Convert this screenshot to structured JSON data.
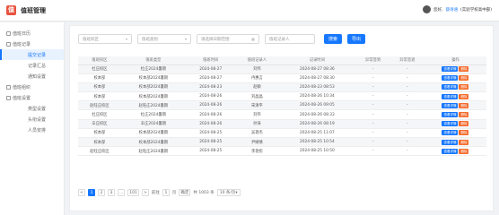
{
  "app": {
    "logo_char": "值",
    "title": "值班管理"
  },
  "user": {
    "greeting": "您好,",
    "name": "薛诗涵",
    "org": "(实验学校高中部)"
  },
  "sidebar": {
    "items": [
      {
        "label": "值班日历",
        "sub": false,
        "icon": "calendar-icon"
      },
      {
        "label": "值班记录",
        "sub": false,
        "icon": "list-icon"
      },
      {
        "label": "提交记录",
        "sub": true,
        "active": true
      },
      {
        "label": "记录汇总",
        "sub": true
      },
      {
        "label": "通知设置",
        "sub": true
      },
      {
        "label": "值班组织",
        "sub": false,
        "icon": "group-icon"
      },
      {
        "label": "值班设置",
        "sub": false,
        "icon": "gear-icon"
      },
      {
        "label": "类型设置",
        "sub": true
      },
      {
        "label": "头衔设置",
        "sub": true
      },
      {
        "label": "人员安排",
        "sub": true
      }
    ]
  },
  "filters": {
    "campus_placeholder": "值班校区",
    "type_placeholder": "值班类别",
    "date_placeholder": "请选择日期范围",
    "person_placeholder": "值班记录人",
    "search_label": "搜索",
    "export_label": "导出"
  },
  "table": {
    "headers": [
      "值班校区",
      "值班类型",
      "值班时间",
      "值班记录人",
      "记录时间",
      "异常签到",
      "异常签退",
      "操作"
    ],
    "rows": [
      [
        "杜庄校区",
        "杜庄2024暑期",
        "2024-08-27",
        "刘伟",
        "2024-08-27 08:36",
        "-",
        "-"
      ],
      [
        "校本部",
        "校本部2024暑期",
        "2024-08-27",
        "冉惠言",
        "2024-08-27 08:30",
        "-",
        "-"
      ],
      [
        "校本部",
        "校本部2024暑期",
        "2024-08-23",
        "赵颖",
        "2024-08-23 08:53",
        "-",
        "-"
      ],
      [
        "校本部",
        "校本部2024暑期",
        "2024-08-26",
        "刘晶晶",
        "2024-08-26 10:34",
        "-",
        "-"
      ],
      [
        "赵旺庄校区",
        "赵旺庄2024暑期",
        "2024-08-26",
        "宋清平",
        "2024-08-26 09:05",
        "-",
        "-"
      ],
      [
        "杜庄校区",
        "杜庄2024暑期",
        "2024-08-26",
        "刘伟",
        "2024-08-26 08:33",
        "-",
        "-"
      ],
      [
        "辛庄校区",
        "辛庄2024暑期",
        "2024-08-26",
        "孙涛",
        "2024-08-26 08:19",
        "-",
        "-"
      ],
      [
        "校本部",
        "校本部2024暑期",
        "2024-08-25",
        "吴艳杰",
        "2024-08-25 11:07",
        "-",
        "-"
      ],
      [
        "校本部",
        "校本部2024暑期",
        "2024-08-25",
        "尹婧倩",
        "2024-08-25 10:54",
        "-",
        "-"
      ],
      [
        "赵旺庄校区",
        "赵旺庄2024暑期",
        "2024-08-25",
        "李艳彤",
        "2024-08-25 10:50",
        "-",
        "-"
      ]
    ],
    "view_label": "查看详情",
    "delete_label": "删除"
  },
  "pager": {
    "prev": "<",
    "pages": [
      "1",
      "2",
      "3",
      "...",
      "101"
    ],
    "next": ">",
    "goto_label": "前往",
    "goto_value": "1",
    "page_unit": "页",
    "confirm_label": "确定",
    "total": "共 1003 条",
    "page_size": "10 条/页"
  }
}
